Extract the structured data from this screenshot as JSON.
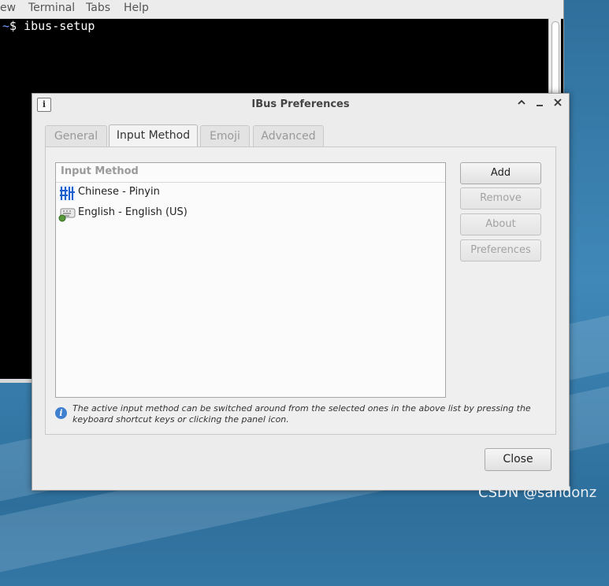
{
  "terminal": {
    "menu": [
      "ew",
      "Terminal",
      "Tabs",
      "Help"
    ],
    "prompt_tilde": "~",
    "command_line": "$ ibus-setup"
  },
  "dialog": {
    "title": "IBus Preferences",
    "tabs": [
      {
        "label": "General"
      },
      {
        "label": "Input Method"
      },
      {
        "label": "Emoji"
      },
      {
        "label": "Advanced"
      }
    ],
    "list": {
      "header": "Input Method",
      "items": [
        {
          "label": "Chinese - Pinyin",
          "icon": "pinyin-icon"
        },
        {
          "label": "English - English (US)",
          "icon": "keyboard-icon"
        }
      ]
    },
    "buttons": {
      "add": "Add",
      "remove": "Remove",
      "about": "About",
      "preferences": "Preferences"
    },
    "info_text": "The active input method can be switched around from the selected ones in the above list by pressing the keyboard shortcut keys or clicking the panel icon.",
    "close": "Close"
  },
  "watermark": "CSDN @sandonz",
  "colors": {
    "accent": "#3f7fd0",
    "desktop": "#3f88b8"
  }
}
